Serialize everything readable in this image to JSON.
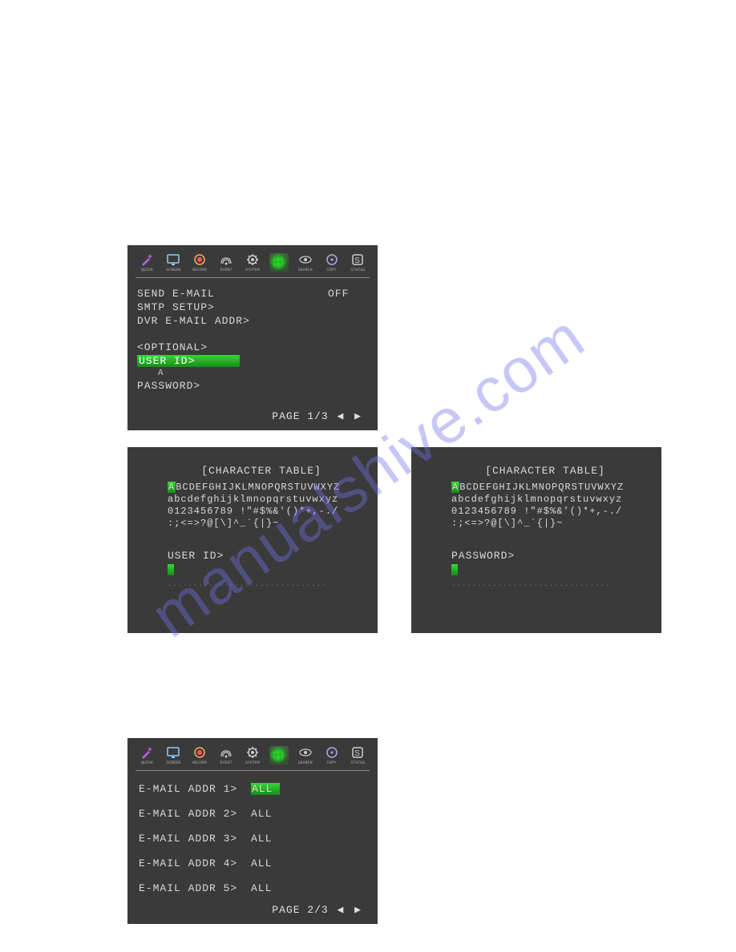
{
  "watermark": "manualshive.com",
  "toolbar": [
    {
      "name": "quick",
      "label": "QUICK"
    },
    {
      "name": "screen",
      "label": "SCREEN"
    },
    {
      "name": "record",
      "label": "RECORD"
    },
    {
      "name": "event",
      "label": "EVENT"
    },
    {
      "name": "system",
      "label": "SYSTEM"
    },
    {
      "name": "network",
      "label": "",
      "active": true
    },
    {
      "name": "search",
      "label": "SEARCH"
    },
    {
      "name": "copy",
      "label": "COPY"
    },
    {
      "name": "status",
      "label": "STATUS"
    }
  ],
  "screen1": {
    "rows": [
      {
        "label": "SEND E-MAIL",
        "value": "OFF"
      },
      {
        "label": "SMTP SETUP>",
        "value": ""
      },
      {
        "label": "DVR E-MAIL ADDR>",
        "value": ""
      }
    ],
    "section": "<OPTIONAL>",
    "user_id_label": "USER ID>",
    "sub_value": "A",
    "password_label": "PASSWORD>",
    "pager_text": "PAGE 1/3"
  },
  "chartable": {
    "title": "[CHARACTER TABLE]",
    "row1": "ABCDEFGHIJKLMNOPQRSTUVWXYZ",
    "row2": "abcdefghijklmnopqrstuvwxyz",
    "row3": "0123456789 !\"#$%&'()*+,-./",
    "row4": ":;<=>?@[\\]^_`{|}~",
    "user_id_label": "USER ID>",
    "password_label": "PASSWORD>",
    "dots": "..............................."
  },
  "screen3": {
    "rows": [
      {
        "label": "E-MAIL ADDR 1>",
        "value": "ALL",
        "active": true
      },
      {
        "label": "E-MAIL ADDR 2>",
        "value": "ALL"
      },
      {
        "label": "E-MAIL ADDR 3>",
        "value": "ALL"
      },
      {
        "label": "E-MAIL ADDR 4>",
        "value": "ALL"
      },
      {
        "label": "E-MAIL ADDR 5>",
        "value": "ALL"
      }
    ],
    "pager_text": "PAGE 2/3"
  }
}
